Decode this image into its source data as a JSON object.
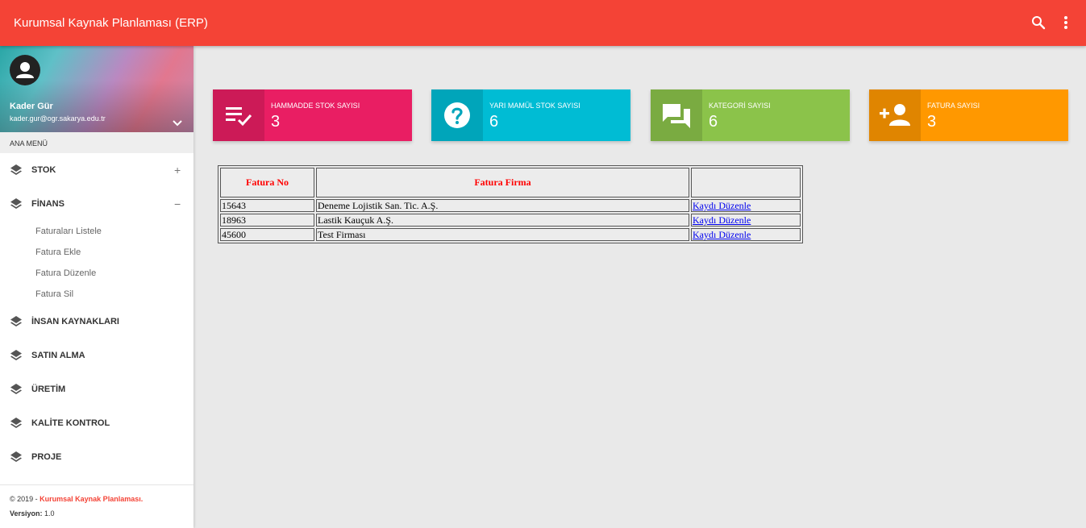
{
  "app": {
    "title": "Kurumsal Kaynak Planlaması (ERP)"
  },
  "user": {
    "name": "Kader Gür",
    "email": "kader.gur@ogr.sakarya.edu.tr"
  },
  "sidebar": {
    "header": "ANA MENÜ",
    "items": [
      {
        "label": "STOK",
        "toggle": "+"
      },
      {
        "label": "FİNANS",
        "toggle": "−",
        "subitems": [
          "Faturaları Listele",
          "Fatura Ekle",
          "Fatura Düzenle",
          "Fatura Sil"
        ]
      },
      {
        "label": "İNSAN KAYNAKLARI"
      },
      {
        "label": "SATIN ALMA"
      },
      {
        "label": "ÜRETİM"
      },
      {
        "label": "KALİTE KONTROL"
      },
      {
        "label": "PROJE"
      }
    ]
  },
  "footer": {
    "copyright": "© 2019 - ",
    "brand": "Kurumsal Kaynak Planlaması.",
    "version_label": "Versiyon:",
    "version": " 1.0"
  },
  "stats": [
    {
      "label": "HAMMADDE STOK SAYISI",
      "value": "3",
      "icon": "playlist-check-icon",
      "color": "#e91e63"
    },
    {
      "label": "YARI MAMÜL STOK SAYISI",
      "value": "6",
      "icon": "help-icon",
      "color": "#00bcd4"
    },
    {
      "label": "KATEGORİ SAYISI",
      "value": "6",
      "icon": "forum-icon",
      "color": "#8bc34a"
    },
    {
      "label": "FATURA SAYISI",
      "value": "3",
      "icon": "person-add-icon",
      "color": "#ff9800"
    }
  ],
  "table": {
    "headers": [
      "Fatura No",
      "Fatura Firma",
      ""
    ],
    "rows": [
      {
        "no": "15643",
        "firma": "Deneme Lojistik San. Tic. A.Ş.",
        "action": "Kaydı Düzenle"
      },
      {
        "no": "18963",
        "firma": "Lastik Kauçuk A.Ş.",
        "action": "Kaydı Düzenle"
      },
      {
        "no": "45600",
        "firma": "Test Firması",
        "action": "Kaydı Düzenle"
      }
    ]
  }
}
